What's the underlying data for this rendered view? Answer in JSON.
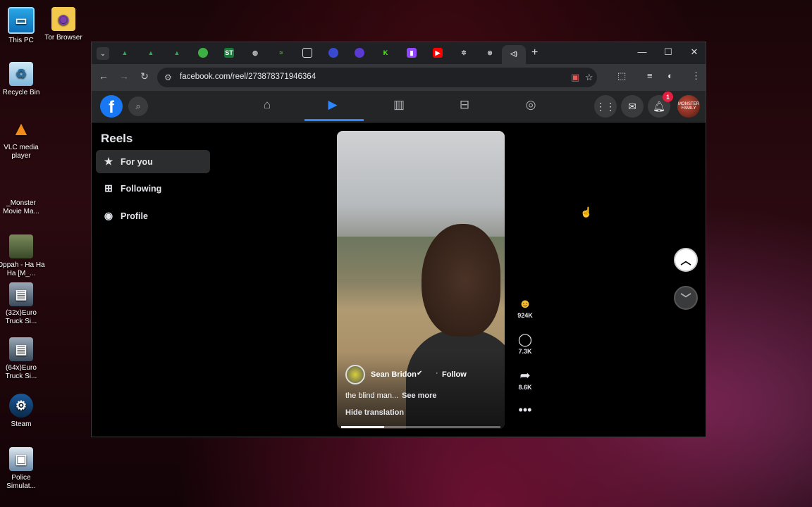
{
  "desktop": {
    "icons": [
      {
        "label": "This PC",
        "icon": "monitor-icon"
      },
      {
        "label": "Tor Browser",
        "icon": "folder-icon"
      },
      {
        "label": "Recycle Bin",
        "icon": "recycle-bin-icon"
      },
      {
        "label": "VLC media player",
        "icon": "vlc-icon"
      },
      {
        "label": "_Monster Movie Ma...",
        "icon": "monster-icon"
      },
      {
        "label": "Oppah - Ha Ha Ha [M_...",
        "icon": "video-thumb-icon"
      },
      {
        "label": "(32x)Euro Truck Si...",
        "icon": "truck-icon"
      },
      {
        "label": "(64x)Euro Truck Si...",
        "icon": "truck-icon"
      },
      {
        "label": "Steam",
        "icon": "steam-icon"
      },
      {
        "label": "Police Simulat...",
        "icon": "police-icon"
      }
    ]
  },
  "browser": {
    "url": "facebook.com/reel/273878371946364",
    "tab_icons": [
      "drive-icon",
      "drive-icon",
      "drive-icon",
      "green-icon",
      "st-icon",
      "globe-icon",
      "comet-icon",
      "image-icon",
      "user-icon",
      "user-icon",
      "k-icon",
      "twitch-icon",
      "youtube-icon",
      "loading-icon",
      "x-icon",
      "audio-icon"
    ]
  },
  "facebook": {
    "notification_count": "1",
    "avatar_text": "MONSTER FAMILY",
    "sidebar": {
      "title": "Reels",
      "items": [
        {
          "label": "For you",
          "icon": "star-icon"
        },
        {
          "label": "Following",
          "icon": "following-icon"
        },
        {
          "label": "Profile",
          "icon": "profile-icon"
        }
      ]
    },
    "reel": {
      "author": "Sean Bridon",
      "verified_glyph": "✔",
      "follow": "Follow",
      "caption": "the blind man...",
      "see_more": "See more",
      "hide_translation": "Hide translation",
      "progress": 0.27,
      "reactions": "924K",
      "comments": "7.3K",
      "shares": "8.6K"
    }
  }
}
